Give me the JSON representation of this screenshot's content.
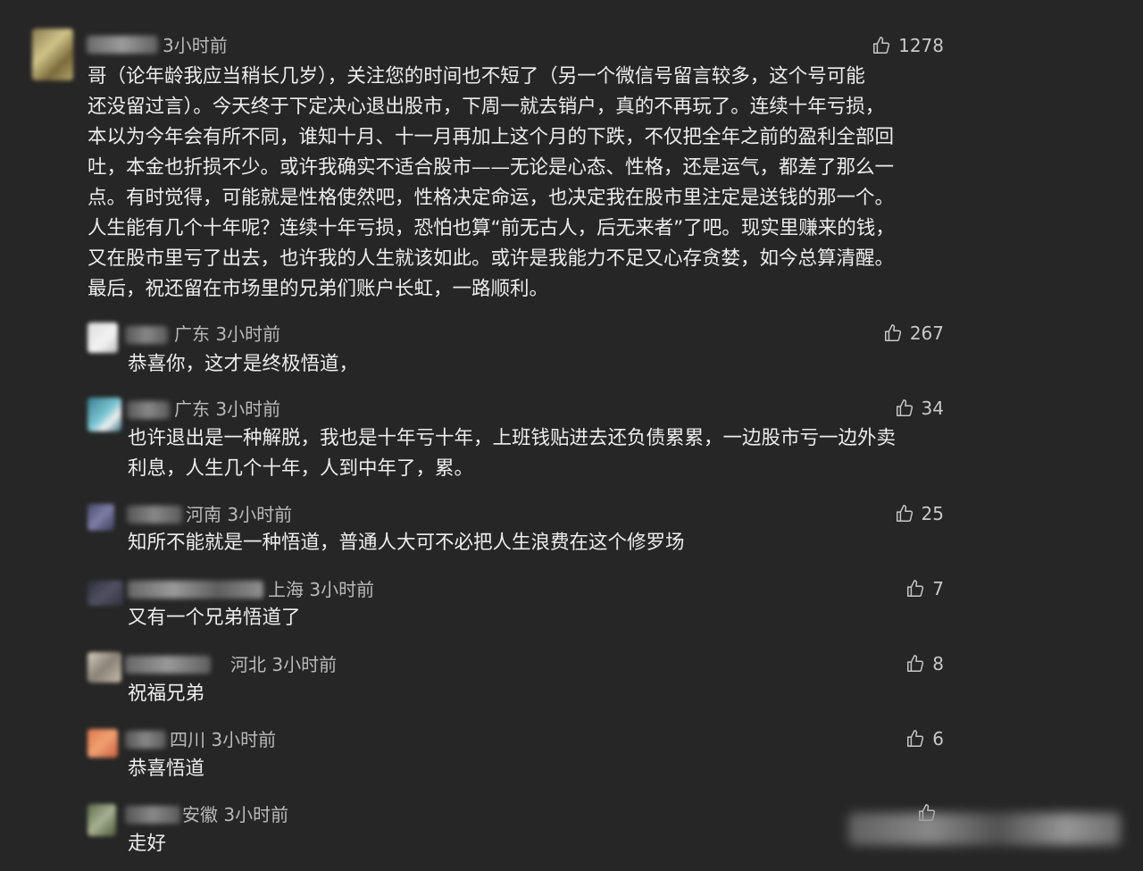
{
  "colors": {
    "background": "#262626",
    "text": "#ededed",
    "meta": "#b9b9b9"
  },
  "like_icon": "thumbs-up-icon",
  "main_comment": {
    "time": "3小时前",
    "likes": "1278",
    "lines": [
      "哥（论年龄我应当稍长几岁），关注您的时间也不短了（另一个微信号留言较多，这个号可能",
      "还没留过言）。今天终于下定决心退出股市，下周一就去销户，真的不再玩了。连续十年亏损，",
      "本以为今年会有所不同，谁知十月、十一月再加上这个月的下跌，不仅把全年之前的盈利全部回",
      "吐，本金也折损不少。或许我确实不适合股市——无论是心态、性格，还是运气，都差了那么一",
      "点。有时觉得，可能就是性格使然吧，性格决定命运，也决定我在股市里注定是送钱的那一个。",
      "人生能有几个十年呢？连续十年亏损，恐怕也算“前无古人，后无来者”了吧。现实里赚来的钱，",
      "又在股市里亏了出去，也许我的人生就该如此。或许是我能力不足又心存贪婪，如今总算清醒。",
      "最后，祝还留在市场里的兄弟们账户长虹，一路顺利。"
    ]
  },
  "replies": [
    {
      "meta": "广东  3小时前",
      "likes": "267",
      "lines": [
        "恭喜你，这才是终极悟道，"
      ]
    },
    {
      "meta": "广东  3小时前",
      "likes": "34",
      "lines": [
        "也许退出是一种解脱，我也是十年亏十年，上班钱贴进去还负债累累，一边股市亏一边外卖",
        "利息，人生几个十年，人到中年了，累。"
      ]
    },
    {
      "meta": "河南  3小时前",
      "likes": "25",
      "lines": [
        "知所不能就是一种悟道，普通人大可不必把人生浪费在这个修罗场"
      ]
    },
    {
      "meta": "上海  3小时前",
      "likes": "7",
      "lines": [
        "又有一个兄弟悟道了"
      ]
    },
    {
      "meta": "河北  3小时前",
      "likes": "8",
      "lines": [
        "祝福兄弟"
      ]
    },
    {
      "meta": "四川  3小时前",
      "likes": "6",
      "lines": [
        "恭喜悟道"
      ]
    },
    {
      "meta": "安徽  3小时前",
      "likes": "",
      "lines": [
        "走好"
      ]
    }
  ]
}
